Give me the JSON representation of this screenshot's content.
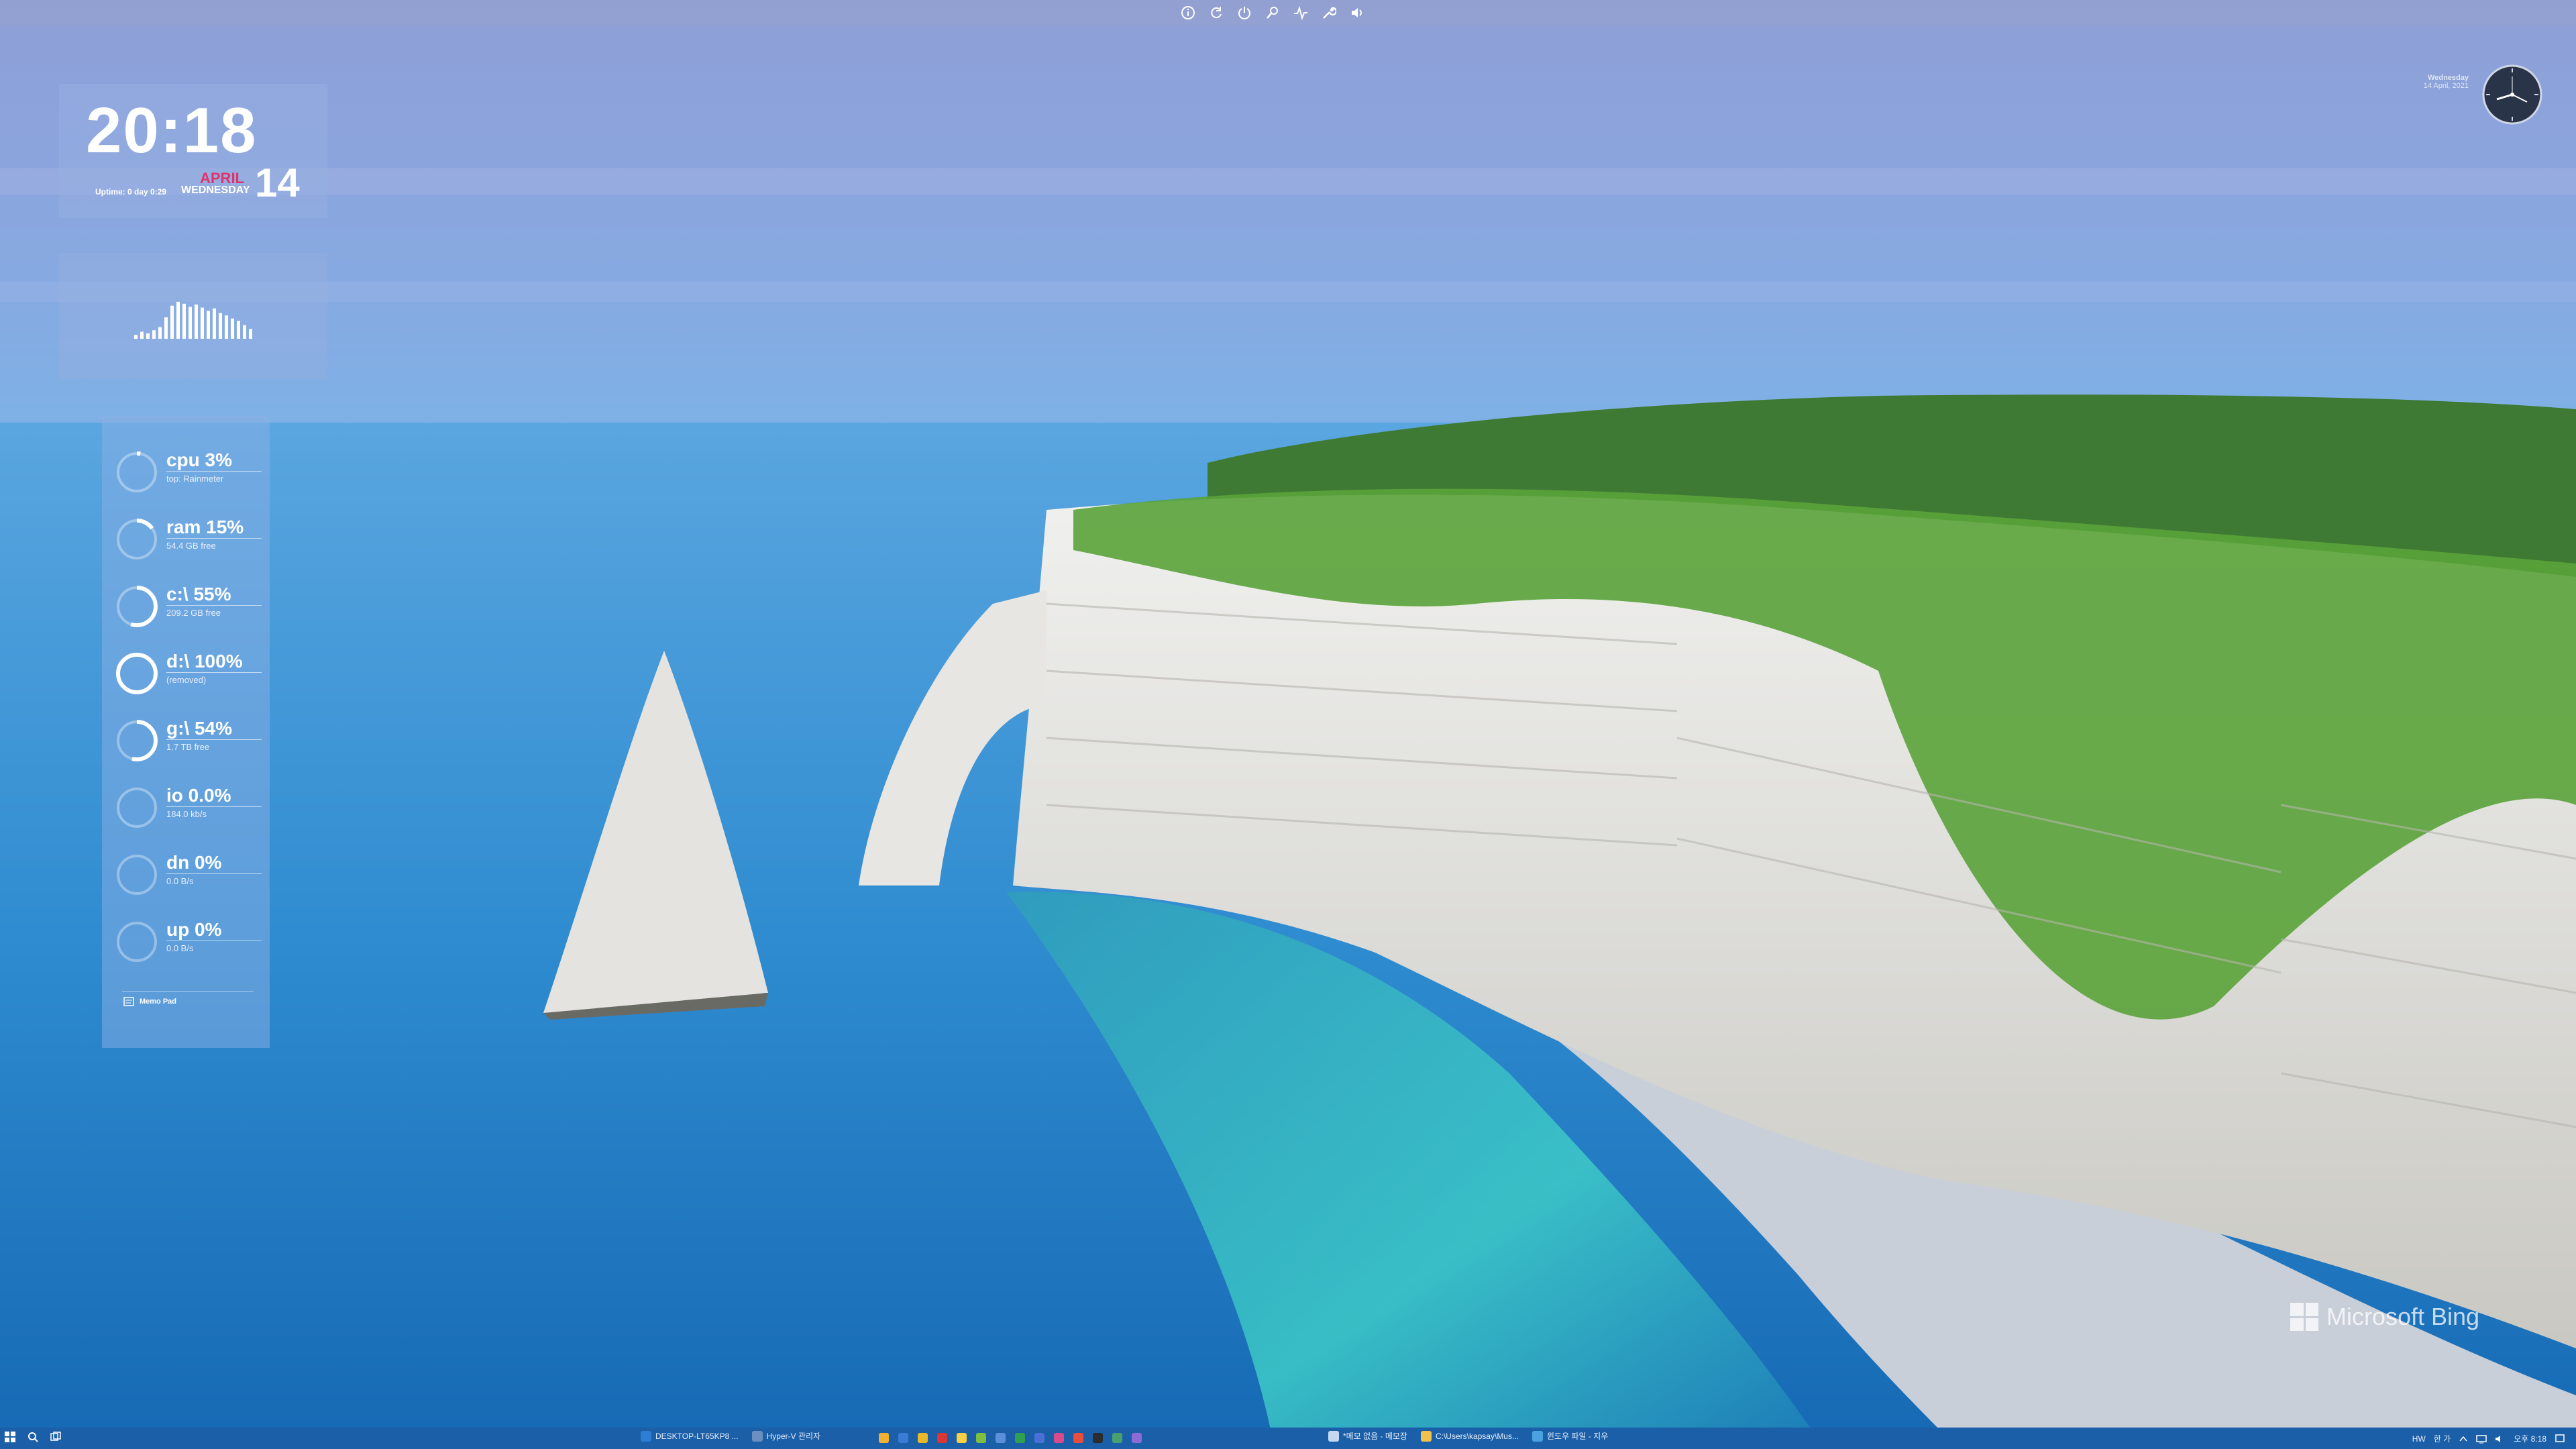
{
  "topbar": {
    "icons": [
      "info-icon",
      "refresh-icon",
      "power-icon",
      "search-icon",
      "activity-icon",
      "wrench-icon",
      "volume-icon"
    ]
  },
  "clock_widget": {
    "time": "20:18",
    "month": "APRIL",
    "day": "14",
    "weekday": "WEDNESDAY",
    "uptime": "Uptime: 0 day 0:29"
  },
  "visualizer": {
    "bars": [
      0.1,
      0.18,
      0.14,
      0.22,
      0.3,
      0.55,
      0.85,
      0.95,
      0.9,
      0.82,
      0.88,
      0.8,
      0.72,
      0.78,
      0.66,
      0.6,
      0.52,
      0.46,
      0.35,
      0.25
    ]
  },
  "meters": [
    {
      "label": "cpu 3%",
      "sub": "top: Rainmeter",
      "level": 0.03
    },
    {
      "label": "ram 15%",
      "sub": "54.4 GB free",
      "level": 0.15
    },
    {
      "label": "c:\\ 55%",
      "sub": "209.2 GB free",
      "level": 0.55
    },
    {
      "label": "d:\\ 100%",
      "sub": "(removed)",
      "level": 1.0
    },
    {
      "label": "g:\\ 54%",
      "sub": "1.7 TB free",
      "level": 0.54
    },
    {
      "label": "io 0.0%",
      "sub": "184.0 kb/s",
      "level": 0.0
    },
    {
      "label": "dn 0%",
      "sub": "0.0  B/s",
      "level": 0.0
    },
    {
      "label": "up 0%",
      "sub": "0.0  B/s",
      "level": 0.0
    }
  ],
  "sysmon_footer": {
    "label": "Memo Pad"
  },
  "right_clock": {
    "weekday": "Wednesday",
    "date": "14 April, 2021"
  },
  "bing": {
    "label": "Microsoft Bing"
  },
  "taskbar": {
    "apps": [
      {
        "label": "DESKTOP-LT65KP8 ...",
        "color": "#2d7dd2"
      },
      {
        "label": "Hyper-V 관리자",
        "color": "#6b8fbf"
      }
    ],
    "apps2": [
      {
        "label": "*메모 없음 - 메모장",
        "color": "#c5d8f0"
      },
      {
        "label": "C:\\Users\\kapsay\\Mus...",
        "color": "#f0c14b"
      },
      {
        "label": "윈도우 파일 - 지우",
        "color": "#4aa3df"
      }
    ],
    "pinned_colors": [
      "#f2b134",
      "#3a7bd5",
      "#e8b828",
      "#d93636",
      "#f7d046",
      "#7fbf3f",
      "#5b8fd9",
      "#30a050",
      "#4a6fd6",
      "#d94a8c",
      "#e84d3d",
      "#2c2c2c",
      "#4a9f6e",
      "#8c6bd6"
    ],
    "tray_text": [
      "HW",
      "한 가",
      "오후 8:18"
    ]
  }
}
